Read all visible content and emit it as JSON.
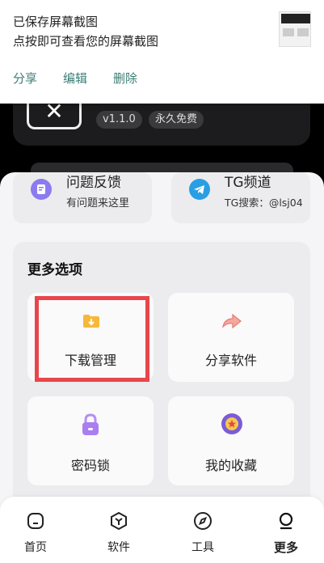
{
  "notification": {
    "line1": "已保存屏幕截图",
    "line2": "点按即可查看您的屏幕截图",
    "actions": [
      "分享",
      "编辑",
      "删除"
    ]
  },
  "app": {
    "version": "v1.1.0",
    "badge": "永久免费"
  },
  "feedback": {
    "title": "问题反馈",
    "subtitle": "有问题来这里"
  },
  "telegram": {
    "title": "TG频道",
    "subtitle": "TG搜索：@lsj04"
  },
  "more": {
    "title": "更多选项",
    "options": [
      {
        "label": "下载管理",
        "icon": "download-folder-icon"
      },
      {
        "label": "分享软件",
        "icon": "share-arrow-icon"
      },
      {
        "label": "密码锁",
        "icon": "lock-icon"
      },
      {
        "label": "我的收藏",
        "icon": "star-favorite-icon"
      }
    ]
  },
  "nav": {
    "items": [
      {
        "label": "首页",
        "icon": "home-icon"
      },
      {
        "label": "软件",
        "icon": "cube-icon"
      },
      {
        "label": "工具",
        "icon": "compass-icon"
      },
      {
        "label": "更多",
        "icon": "more-icon",
        "active": true
      }
    ]
  },
  "colors": {
    "accent_teal": "#3a7d75",
    "highlight_red": "#e8464a",
    "telegram_blue": "#2a9ee4",
    "feedback_purple": "#8b7bf0"
  }
}
